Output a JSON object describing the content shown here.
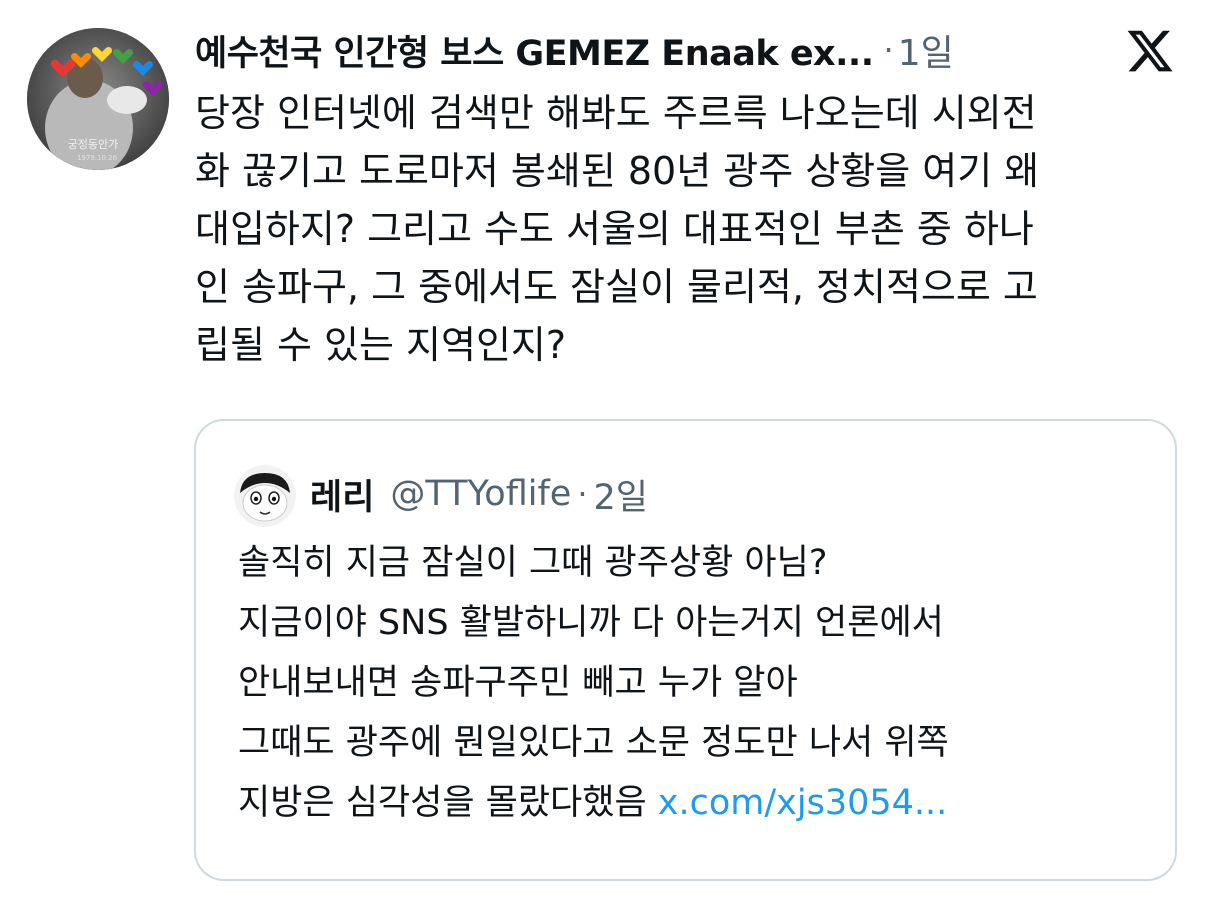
{
  "tweet": {
    "author_name": "예수천국 인간형 보스 GEMEZ Enaak ex...",
    "separator": "·",
    "time": "1일",
    "platform_icon": "x-logo-icon",
    "avatar_caption": "궁정동안가",
    "avatar_date": "1979.10.26",
    "lines": [
      "당장 인터넷에 검색만 해봐도 주르륵 나오는데 시외전",
      "화 끊기고 도로마저 봉쇄된 80년 광주 상황을 여기 왜",
      "대입하지? 그리고 수도 서울의 대표적인 부촌 중 하나",
      "인 송파구, 그 중에서도 잠실이 물리적, 정치적으로 고",
      "립될 수 있는 지역인지?"
    ]
  },
  "quoted": {
    "name": "레리",
    "handle": "@TTYoflife",
    "separator": "·",
    "time": "2일",
    "lines": [
      "솔직히 지금 잠실이 그때 광주상황 아님?",
      "지금이야 SNS 활발하니까 다 아는거지 언론에서",
      "안내보내면 송파구주민 빼고 누가 알아",
      "그때도 광주에 뭔일있다고 소문 정도만 나서 위쪽"
    ],
    "last_line_text": "지방은 심각성을 몰랐다했음",
    "link": "x.com/xjs3054..."
  },
  "colors": {
    "text": "#0f1419",
    "secondary": "#536471",
    "link": "#1d9bf0",
    "border": "#cfd9de"
  }
}
